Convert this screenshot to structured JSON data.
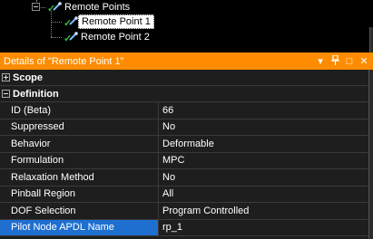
{
  "tree": {
    "items": [
      {
        "label": "Remote Points",
        "icon": "remote-points-folder-icon",
        "selected": false
      },
      {
        "label": "Remote Point 1",
        "icon": "remote-point-icon",
        "selected": true
      },
      {
        "label": "Remote Point 2",
        "icon": "remote-point-icon",
        "selected": false
      }
    ]
  },
  "details": {
    "title": "Details of \"Remote Point 1\"",
    "controls": {
      "dropdown": "▾",
      "pin": "📌",
      "maximize": "□",
      "close": "✕"
    },
    "title_color": "#ff8c00",
    "sections": [
      {
        "label": "Scope",
        "expanded": false
      },
      {
        "label": "Definition",
        "expanded": true
      }
    ],
    "rows": [
      {
        "name": "ID (Beta)",
        "value": "66"
      },
      {
        "name": "Suppressed",
        "value": "No"
      },
      {
        "name": "Behavior",
        "value": "Deformable"
      },
      {
        "name": "Formulation",
        "value": "MPC"
      },
      {
        "name": "Relaxation Method",
        "value": "No"
      },
      {
        "name": "Pinball Region",
        "value": "All"
      },
      {
        "name": "DOF Selection",
        "value": "Program Controlled"
      },
      {
        "name": "Pilot Node APDL Name",
        "value": "rp_1"
      }
    ],
    "selected_row_color": "#1e6fd0"
  }
}
